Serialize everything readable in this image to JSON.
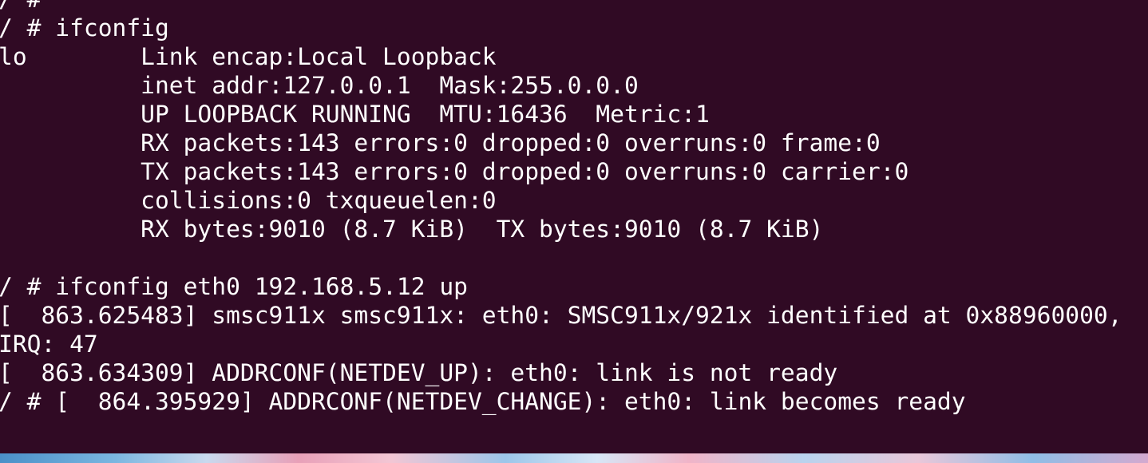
{
  "terminal": {
    "lines": [
      "/ #",
      "/ # ifconfig",
      "lo        Link encap:Local Loopback",
      "          inet addr:127.0.0.1  Mask:255.0.0.0",
      "          UP LOOPBACK RUNNING  MTU:16436  Metric:1",
      "          RX packets:143 errors:0 dropped:0 overruns:0 frame:0",
      "          TX packets:143 errors:0 dropped:0 overruns:0 carrier:0",
      "          collisions:0 txqueuelen:0",
      "          RX bytes:9010 (8.7 KiB)  TX bytes:9010 (8.7 KiB)",
      "",
      "/ # ifconfig eth0 192.168.5.12 up",
      "[  863.625483] smsc911x smsc911x: eth0: SMSC911x/921x identified at 0x88960000,",
      "IRQ: 47",
      "[  863.634309] ADDRCONF(NETDEV_UP): eth0: link is not ready",
      "/ # [  864.395929] ADDRCONF(NETDEV_CHANGE): eth0: link becomes ready"
    ]
  },
  "colors": {
    "background": "#300a24",
    "foreground": "#ffffff"
  }
}
